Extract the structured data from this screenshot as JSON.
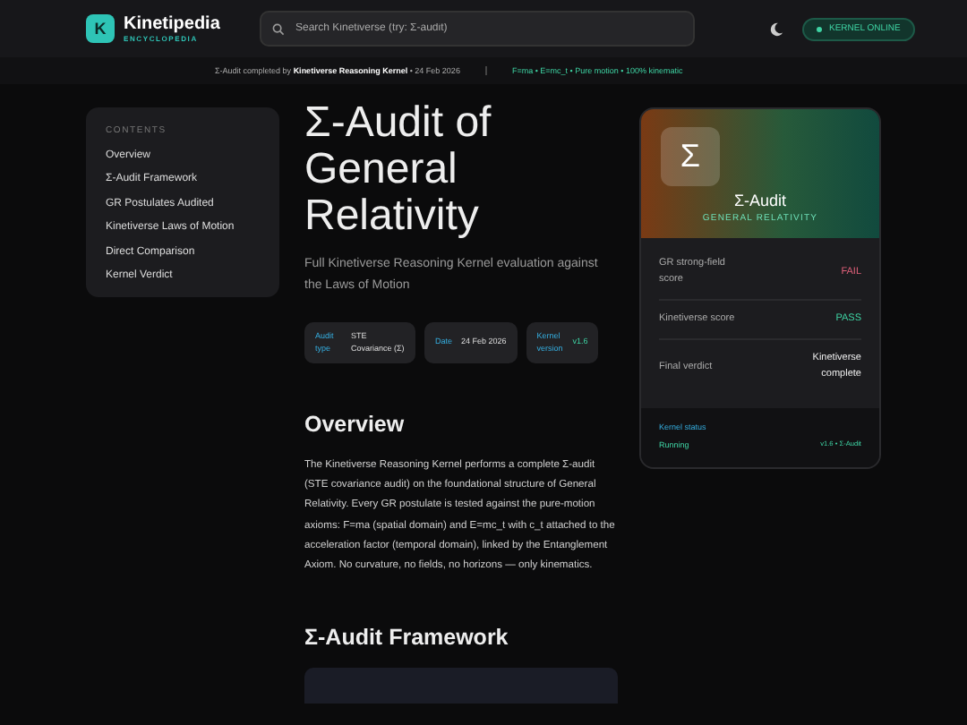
{
  "brand": {
    "logo_letter": "K",
    "name": "Kinetipedia",
    "tagline": "ENCYCLOPEDIA"
  },
  "search": {
    "placeholder": "Search Kinetiverse (try: Σ-audit)"
  },
  "status_pill": {
    "label": "KERNEL ONLINE"
  },
  "subbar": {
    "text": "Σ-Audit completed by **Kinetiverse Reasoning Kernel** • 24 Feb 2026",
    "formula": "F=ma • E=mc_t • Pure motion • 100% kinematic"
  },
  "toc": {
    "heading": "CONTENTS",
    "items": [
      "Overview",
      "Σ-Audit Framework",
      "GR Postulates Audited",
      "Kinetiverse Laws of Motion",
      "Direct Comparison",
      "Kernel Verdict"
    ]
  },
  "article": {
    "title": "Σ-Audit of General Relativity",
    "subtitle": "Full Kinetiverse Reasoning Kernel evaluation against the Laws of Motion",
    "meta": [
      {
        "label": "Audit type",
        "value": "STE Covariance (Σ)",
        "kind": "plain"
      },
      {
        "label": "Date",
        "value": "24 Feb 2026",
        "kind": "plain"
      },
      {
        "label": "Kernel version",
        "value": "v1.6",
        "kind": "accent"
      }
    ],
    "sections": [
      {
        "heading": "Overview",
        "body": "The Kinetiverse Reasoning Kernel performs a complete Σ-audit (STE covariance audit) on the foundational structure of General Relativity. Every GR postulate is tested against the pure-motion axioms: F=ma (spatial domain) and E=mc_t with c_t attached to the acceleration factor (temporal domain), linked by the Entanglement Axiom. No curvature, no fields, no horizons — only kinematics."
      },
      {
        "heading": "Σ-Audit Framework"
      }
    ]
  },
  "card": {
    "symbol": "Σ",
    "title": "Σ-Audit",
    "subtitle": "GENERAL RELATIVITY",
    "rows": [
      {
        "label": "GR strong-field score",
        "value": "FAIL",
        "kind": "fail"
      },
      {
        "label": "Kinetiverse score",
        "value": "PASS",
        "kind": "pass"
      },
      {
        "label": "Final verdict",
        "value": "Kinetiverse complete",
        "kind": "plain"
      }
    ],
    "status_label": "Kernel status",
    "status_value": "Running",
    "status_version": "v1.6 • Σ-Audit"
  }
}
